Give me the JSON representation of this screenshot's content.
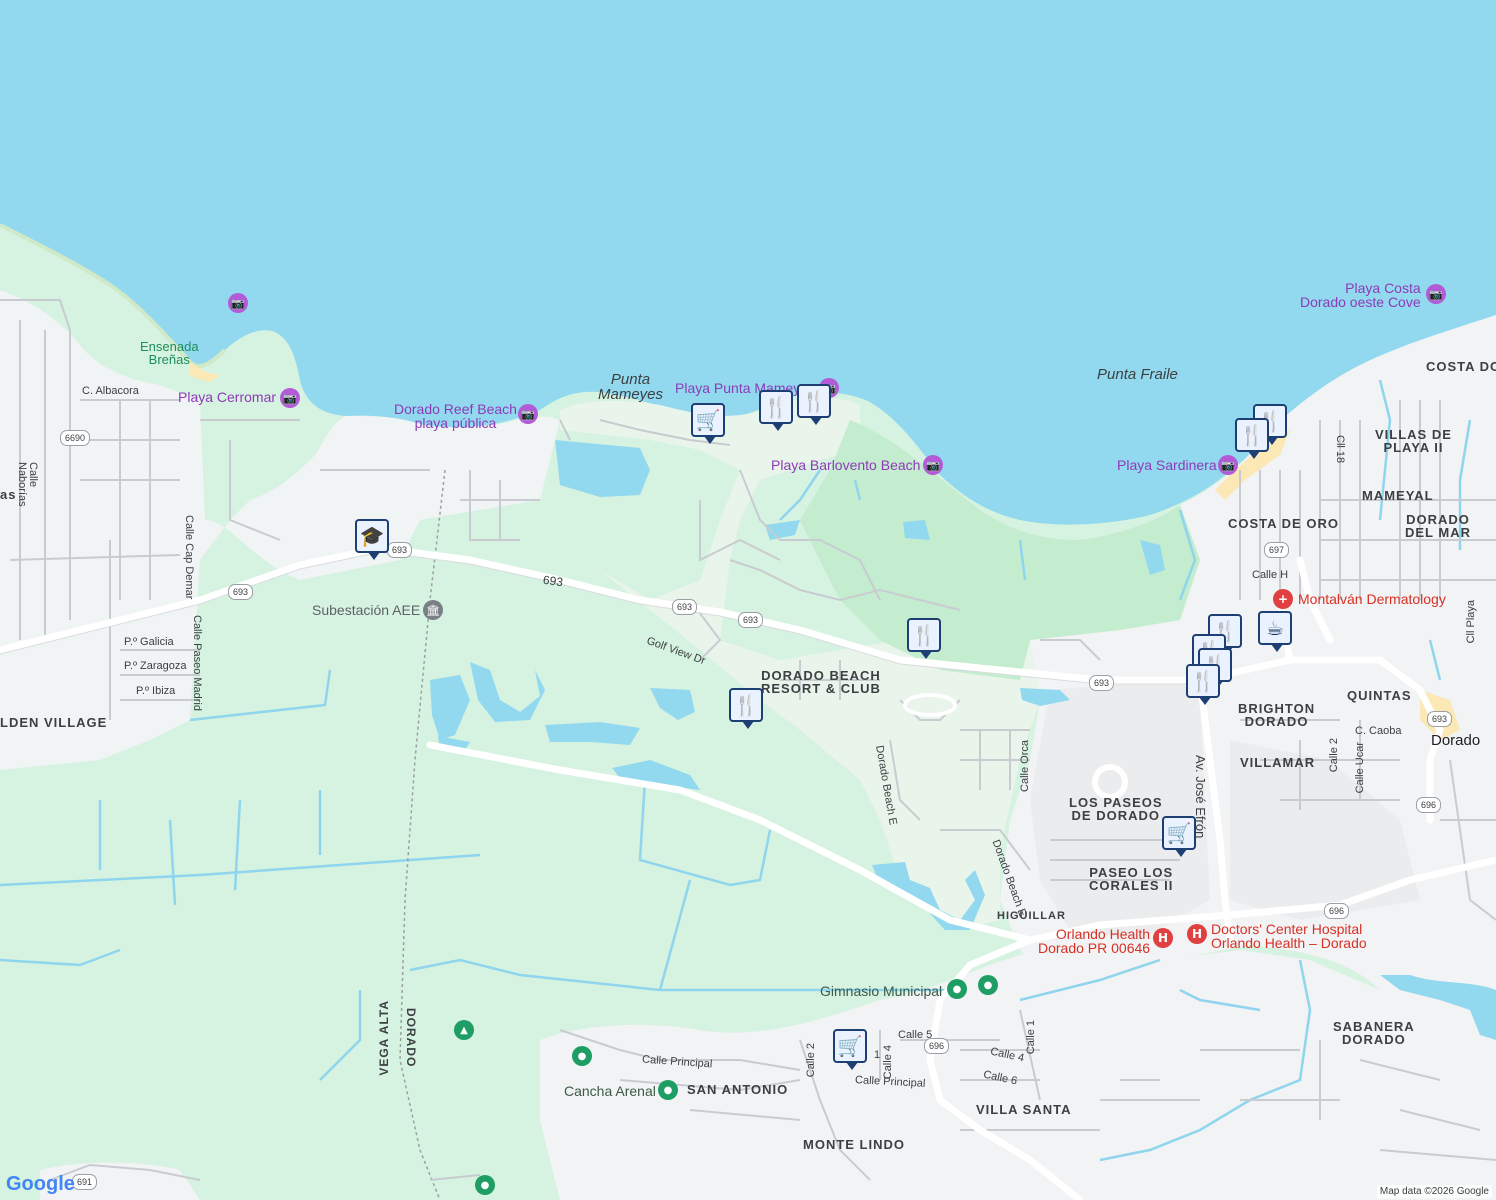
{
  "colors": {
    "water": "#92d9ef",
    "park": "#cff0d9",
    "urban": "#f1f3f4",
    "road": "#ffffff",
    "poi_purple": "#8d3bb8",
    "pin_navy": "#1d3f73"
  },
  "water_labels": {
    "punta_mameyes": "Punta\nMameyes",
    "punta_fraile": "Punta Fraile"
  },
  "pois": {
    "ensenada": "Ensenada\nBreñas",
    "cerromar": "Playa Cerromar",
    "dorado_reef": "Dorado Reef Beach\nplaya pública",
    "punta_mameyes_beach": "Playa Punta Mameyes",
    "barlovento": "Playa Barlovento Beach",
    "sardinera": "Playa Sardinera",
    "costa_dorado": "Playa Costa\nDorado oeste Cove",
    "subestacion": "Subestación AEE",
    "montalvan": "Montalván Dermatology",
    "orlando_health": "Orlando Health\nDorado PR 00646",
    "doctors_center": "Doctors' Center Hospital\nOrlando Health – Dorado",
    "gimnasio": "Gimnasio Municipal",
    "cancha": "Cancha Arenal"
  },
  "areas": {
    "costa_do": "COSTA DO",
    "villas_playa": "VILLAS DE\nPLAYA II",
    "mameyal": "MAMEYAL",
    "dorado_del_mar": "DORADO\nDEL MAR",
    "costa_de_oro": "COSTA DE ORO",
    "dorado_beach_resort": "DORADO BEACH\nRESORT & CLUB",
    "brighton": "BRIGHTON\nDORADO",
    "quintas": "QUINTAS",
    "villamar": "VILLAMAR",
    "dorado_city": "Dorado",
    "los_paseos": "LOS PASEOS\nDE DORADO",
    "paseo_corales": "PASEO LOS\nCORALES II",
    "higuillar": "HIGUILLAR",
    "sabanera": "SABANERA\nDORADO",
    "san_antonio": "SAN ANTONIO",
    "villa_santa": "VILLA SANTA",
    "monte_lindo": "MONTE LINDO",
    "golden_village": "LDEN VILLAGE",
    "as_edge": "as",
    "dorado_boundary": "DORADO",
    "vega_alta": "VEGA ALTA"
  },
  "streets": {
    "albacora": "C. Albacora",
    "naborias": "Calle\nNaborías",
    "cap_demar": "Calle Cap Demar",
    "paseo_madrid": "Calle Paseo Madrid",
    "galicia": "P.º Galicia",
    "zaragoza": "P.º Zaragoza",
    "ibiza": "P.º Ibiza",
    "golf_view": "Golf View Dr",
    "dorado_beach_e1": "Dorado Beach E",
    "dorado_beach_e2": "Dorado Beach E",
    "calle_orca": "Calle Orca",
    "av_jose_efron": "Av. José Efrón",
    "calle_h": "Calle H",
    "cll18": "Cll 18",
    "cll_playa": "Cll Playa",
    "calle2": "Calle 2",
    "calle_ucar": "Calle Ucar",
    "c_caoba": "C. Caoba",
    "calle5": "Calle 5",
    "calle_principal1": "Calle Principal",
    "calle_principal2": "Calle Principal",
    "calle2b": "Calle 2",
    "calle4": "Calle 4",
    "calle4b": "Calle 4",
    "calle6": "Calle 6",
    "calle1": "Calle 1",
    "calle1b": "1",
    "route_693_text": "693"
  },
  "shields": [
    "6690",
    "693",
    "693",
    "693",
    "693",
    "693",
    "697",
    "693",
    "696",
    "696",
    "696",
    "691"
  ],
  "pins": [
    {
      "icon": "cart-icon",
      "glyph": "🛒"
    },
    {
      "icon": "restaurant-icon",
      "glyph": "🍴"
    },
    {
      "icon": "restaurant-icon",
      "glyph": "🍴"
    },
    {
      "icon": "school-icon",
      "glyph": "🎓"
    },
    {
      "icon": "restaurant-icon",
      "glyph": "🍴"
    },
    {
      "icon": "restaurant-icon",
      "glyph": "🍴"
    },
    {
      "icon": "restaurant-icon",
      "glyph": "🍴"
    },
    {
      "icon": "restaurant-icon",
      "glyph": "🍴"
    },
    {
      "icon": "restaurant-icon",
      "glyph": "🍴"
    },
    {
      "icon": "restaurant-icon",
      "glyph": "🍴"
    },
    {
      "icon": "restaurant-icon",
      "glyph": "🍴"
    },
    {
      "icon": "restaurant-icon",
      "glyph": "🍴"
    },
    {
      "icon": "coffee-icon",
      "glyph": "☕"
    },
    {
      "icon": "cart-icon",
      "glyph": "🛒"
    },
    {
      "icon": "cart-icon",
      "glyph": "🛒"
    }
  ],
  "google": "Google",
  "attribution": "Map data ©2026 Google"
}
